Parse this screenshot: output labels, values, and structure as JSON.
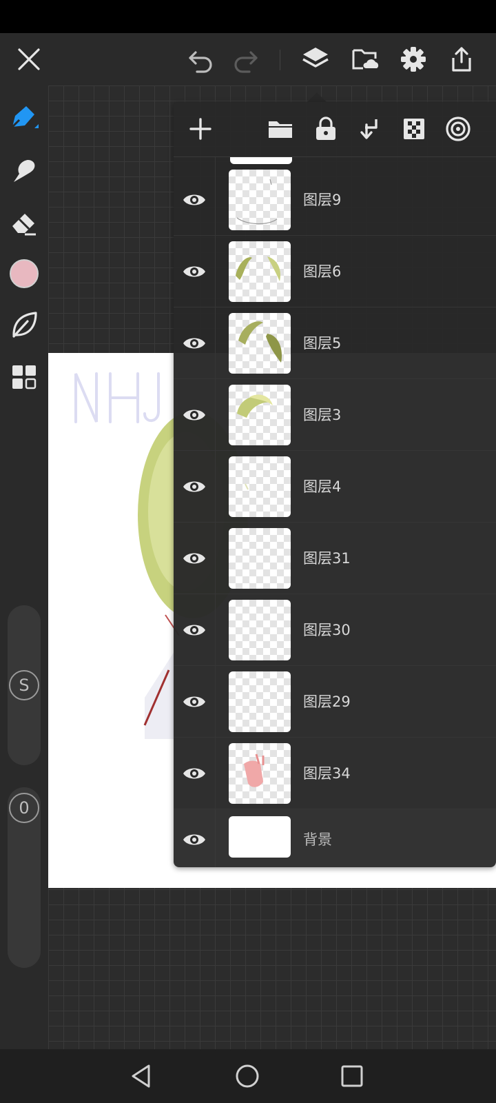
{
  "colors": {
    "accent": "#2196f3",
    "brush_color": "#e8b8c0",
    "panel_bg": "#282828",
    "icon": "#e6e6e6"
  },
  "topbar": {
    "icons": [
      "close-icon",
      "undo-icon",
      "redo-icon",
      "layers-icon",
      "cloud-folder-icon",
      "settings-icon",
      "export-icon"
    ]
  },
  "sidebar": {
    "tools": [
      "pencil-icon",
      "smudge-icon",
      "eraser-icon",
      "color-swatch",
      "leaf-icon",
      "grid-icon"
    ],
    "size_slider_label": "S",
    "opacity_slider_label": "0"
  },
  "layers_panel": {
    "toolbar_icons": [
      "add-layer-icon",
      "folder-icon",
      "lock-icon",
      "merge-down-icon",
      "alpha-lock-icon",
      "blend-mode-icon"
    ],
    "layers": [
      {
        "name": "图层9",
        "visible": true
      },
      {
        "name": "图层6",
        "visible": true
      },
      {
        "name": "图层5",
        "visible": true
      },
      {
        "name": "图层3",
        "visible": true
      },
      {
        "name": "图层4",
        "visible": true
      },
      {
        "name": "图层31",
        "visible": true
      },
      {
        "name": "图层30",
        "visible": true
      },
      {
        "name": "图层29",
        "visible": true
      },
      {
        "name": "图层34",
        "visible": true
      }
    ],
    "background_layer": {
      "name": "背景",
      "visible": true
    }
  },
  "navbar": {
    "icons": [
      "back-icon",
      "home-icon",
      "recents-icon"
    ]
  }
}
